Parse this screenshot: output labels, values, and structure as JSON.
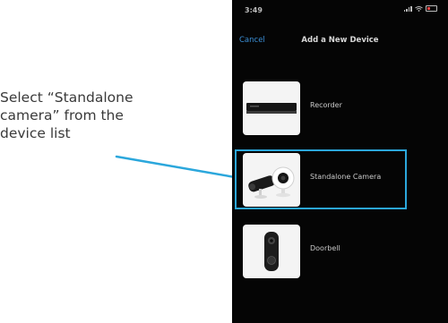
{
  "instruction": {
    "line1": "Select “Standalone",
    "line2": "camera” from the",
    "line3": "device list"
  },
  "status_bar": {
    "time": "3:49"
  },
  "nav": {
    "cancel_label": "Cancel",
    "title": "Add a New Device"
  },
  "devices": [
    {
      "label": "Recorder",
      "icon": "recorder-icon"
    },
    {
      "label": "Standalone Camera",
      "icon": "camera-icon"
    },
    {
      "label": "Doorbell",
      "icon": "doorbell-icon"
    }
  ],
  "colors": {
    "highlight": "#2ba7dc",
    "cancel": "#3b8fd6",
    "phone_background": "#050505"
  }
}
